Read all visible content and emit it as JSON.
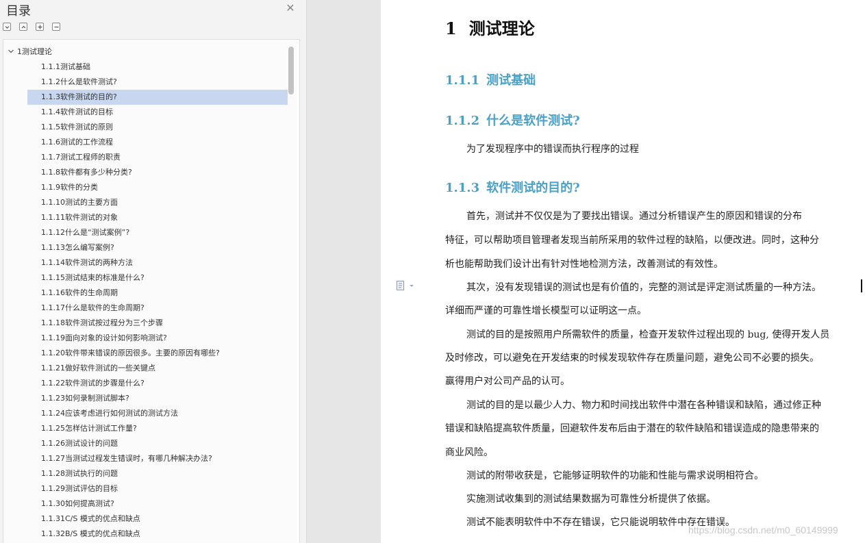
{
  "toc": {
    "title": "目录",
    "root_label": "1测试理论",
    "selected_index": 2,
    "items": [
      "1.1.1测试基础",
      "1.1.2什么是软件测试?",
      "1.1.3软件测试的目的?",
      "1.1.4软件测试的目标",
      "1.1.5软件测试的原则",
      "1.1.6测试的工作流程",
      "1.1.7测试工程师的职责",
      "1.1.8软件都有多少种分类?",
      "1.1.9软件的分类",
      "1.1.10测试的主要方面",
      "1.1.11软件测试的对象",
      "1.1.12什么是“测试案例”?",
      "1.1.13怎么编写案例?",
      "1.1.14软件测试的两种方法",
      "1.1.15测试结束的标准是什么?",
      "1.1.16软件的生命周期",
      "1.1.17什么是软件的生命周期?",
      "1.1.18软件测试按过程分为三个步骤",
      "1.1.19面向对象的设计如何影响测试?",
      "1.1.20软件带来错误的原因很多。主要的原因有哪些?",
      "1.1.21做好软件测试的一些关键点",
      "1.1.22软件测试的步骤是什么?",
      "1.1.23如何录制测试脚本?",
      "1.1.24应该考虑进行如何测试的测试方法",
      "1.1.25怎样估计测试工作量?",
      "1.1.26测试设计的问题",
      "1.1.27当测试过程发生错误时，有哪几种解决办法?",
      "1.1.28测试执行的问题",
      "1.1.29测试评估的目标",
      "1.1.30如何提高测试?",
      "1.1.31C/S 模式的优点和缺点",
      "1.1.32B/S 模式的优点和缺点"
    ]
  },
  "doc": {
    "h1": {
      "num": "1",
      "text": "测试理论"
    },
    "sections": [
      {
        "num": "1.1.1",
        "text": "测试基础"
      },
      {
        "num": "1.1.2",
        "text": "什么是软件测试?"
      },
      {
        "num": "1.1.3",
        "text": "软件测试的目的?"
      }
    ],
    "def_line": "为了发现程序中的错误而执行程序的过程",
    "lines": [
      "首先，测试并不仅仅是为了要找出错误。通过分析错误产生的原因和错误的分布",
      "特征，可以帮助项目管理者发现当前所采用的软件过程的缺陷，以便改进。同时，这种分",
      "析也能帮助我们设计出有针对性地检测方法，改善测试的有效性。",
      "其次，没有发现错误的测试也是有价值的，完整的测试是评定测试质量的一种方法。",
      "详细而严谨的可靠性增长模型可以证明这一点。",
      "测试的目的是按照用户所需软件的质量，检查开发软件过程出现的 bug, 使得开发人员",
      "及时修改，可以避免在开发结束的时候发现软件存在质量问题，避免公司不必要的损失。",
      "赢得用户对公司产品的认可。",
      "测试的目的是以最少人力、物力和时间找出软件中潜在各种错误和缺陷，通过修正种",
      "错误和缺陷提高软件质量，回避软件发布后由于潜在的软件缺陷和错误造成的隐患带来的",
      "商业风险。",
      "测试的附带收获是，它能够证明软件的功能和性能与需求说明相符合。",
      "实施测试收集到的测试结果数据为可靠性分析提供了依据。",
      "测试不能表明软件中不存在错误，它只能说明软件中存在错误。"
    ]
  },
  "watermark": "https://blog.csdn.net/m0_60149999",
  "colors": {
    "heading_blue": "#4aa0c6",
    "selection": "#c9d6ef"
  }
}
